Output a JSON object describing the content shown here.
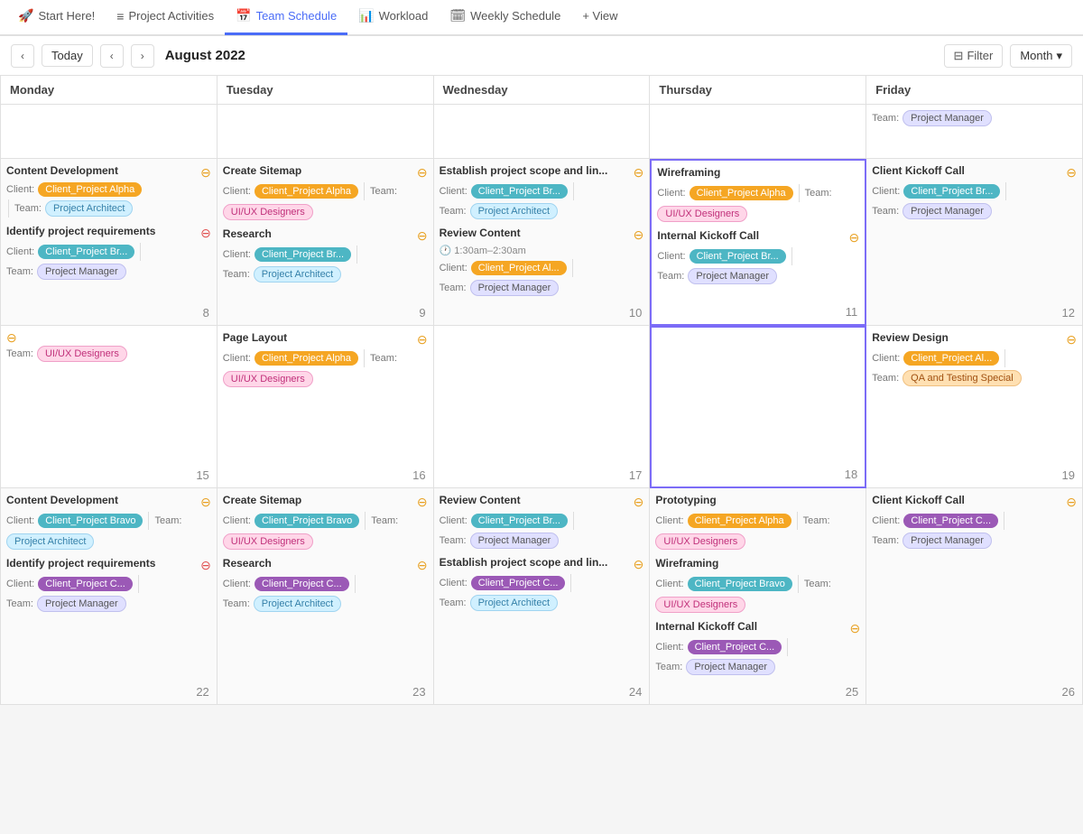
{
  "nav": {
    "tabs": [
      {
        "id": "start",
        "label": "Start Here!",
        "icon": "🚀",
        "active": false
      },
      {
        "id": "project-activities",
        "label": "Project Activities",
        "icon": "≡",
        "active": false
      },
      {
        "id": "team-schedule",
        "label": "Team Schedule",
        "icon": "📅",
        "active": true
      },
      {
        "id": "workload",
        "label": "Workload",
        "icon": "📊",
        "active": false
      },
      {
        "id": "weekly-schedule",
        "label": "Weekly Schedule",
        "icon": "🗓",
        "active": false
      },
      {
        "id": "view",
        "label": "+ View",
        "icon": "",
        "active": false
      }
    ]
  },
  "toolbar": {
    "today_label": "Today",
    "month_title": "August 2022",
    "filter_label": "Filter",
    "month_label": "Month"
  },
  "days": [
    "Monday",
    "Tuesday",
    "Wednesday",
    "Thursday",
    "Friday"
  ],
  "week1_numbers": [
    8,
    9,
    10,
    11,
    12
  ],
  "week2_numbers": [
    15,
    16,
    17,
    18,
    19
  ],
  "week3_numbers": [
    22,
    23,
    24,
    25,
    26
  ],
  "tags": {
    "client_alpha": {
      "label": "Client_Project Alpha",
      "cls": "tag-orange"
    },
    "client_bravo": {
      "label": "Client_Project Br...",
      "cls": "tag-teal"
    },
    "client_charlie": {
      "label": "Client_Project C...",
      "cls": "tag-purple"
    },
    "client_bravo_full": {
      "label": "Client_Project Bravo",
      "cls": "tag-teal"
    },
    "project_architect": {
      "label": "Project Architect",
      "cls": "tag-pa"
    },
    "project_manager": {
      "label": "Project Manager",
      "cls": "tag-pm"
    },
    "uiux": {
      "label": "UI/UX Designers",
      "cls": "tag-uiux"
    },
    "qa": {
      "label": "QA and Testing Special",
      "cls": "tag-qa"
    },
    "client_al": {
      "label": "Client_Project Al...",
      "cls": "tag-orange"
    },
    "client_br2": {
      "label": "Client_Project Br...",
      "cls": "tag-teal"
    }
  }
}
